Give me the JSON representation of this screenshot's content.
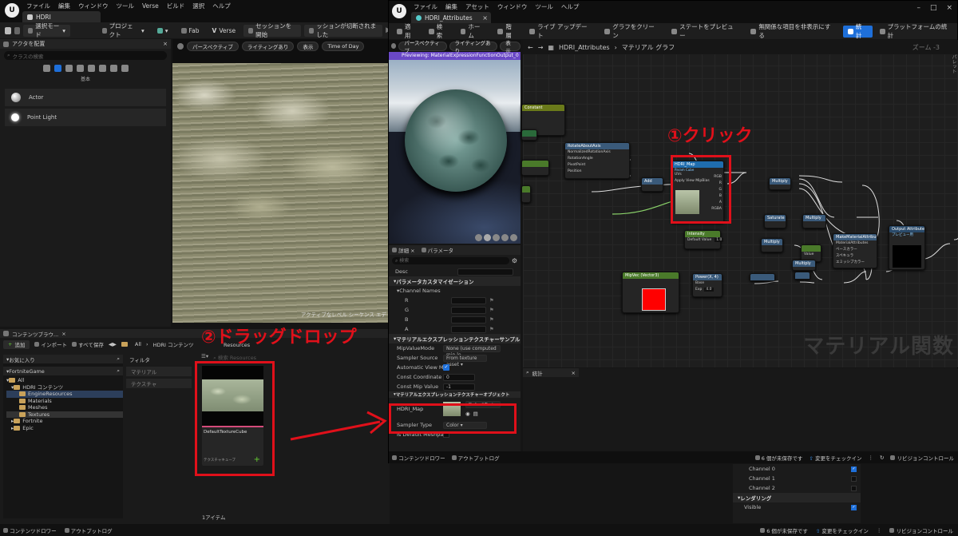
{
  "left_window": {
    "title_tab": "HDRI",
    "menu": [
      "ファイル",
      "編集",
      "ウィンドウ",
      "ツール",
      "Verse",
      "ビルド",
      "選択",
      "ヘルプ"
    ],
    "toolbar": {
      "select_mode": "選択モード",
      "project": "プロジェクト",
      "fab": "Fab",
      "verse": "Verse",
      "session": "セッションを開始",
      "disconnected": "ッションが切断されました"
    },
    "place_actors": {
      "title": "アクタを配置",
      "search_placeholder": "クラスの検索",
      "category": "基本",
      "items": [
        "Actor",
        "Point Light"
      ]
    },
    "viewport": {
      "perspective": "パースペクティブ",
      "lighting": "ライティングあり",
      "show": "表示",
      "time_of_day": "Time of Day",
      "active_sequence": "アクティブなレベル シーケンス エデ"
    },
    "content_browser": {
      "tab": "コンテンツブラウ...",
      "add": "追加",
      "import": "インポート",
      "save_all": "すべて保存",
      "path_all": "All",
      "path_hdri": "HDRI コンテンツ",
      "favorites": "お気に入り",
      "project": "FortniteGame",
      "tree": [
        "All",
        "HDRI コンテンツ",
        "EngineResources",
        "Materials",
        "Meshes",
        "Textures",
        "Fortnite",
        "Epic"
      ],
      "filter": "フィルタ",
      "filters": [
        "マテリアル",
        "テクスチャ"
      ],
      "resources": "Resources",
      "search_placeholder": "検索 Resources",
      "asset_name": "DefaultTextureCube",
      "asset_type": "テクスチャキューブ",
      "item_count": "1アイテム"
    },
    "bottom": {
      "drawer": "コンテンツドロワー",
      "output_log": "アウトプットログ",
      "unsaved": "6 個が未保存です",
      "checkin": "変更をチェックイン",
      "revision": "リビジョンコントロール"
    }
  },
  "right_window": {
    "title_tab": "HDRI_Attributes",
    "menu": [
      "ファイル",
      "編集",
      "アセット",
      "ウィンドウ",
      "ツール",
      "ヘルプ"
    ],
    "toolbar": [
      "適用",
      "検索",
      "ホーム",
      "階層",
      "ライブ アップデート",
      "グラフをクリーン",
      "ステートをプレビュー",
      "無関係な項目を非表示にする",
      "統計",
      "プラットフォームの統計"
    ],
    "breadcrumb": {
      "asset": "HDRI_Attributes",
      "graph": "マテリアル グラフ",
      "zoom": "ズーム -3",
      "palette": "パレット"
    },
    "preview": {
      "perspective": "パースペクティブ",
      "lighting": "ライティングあり",
      "show": "表示",
      "previewing": "Previewing: MaterialExpressionFunctionOutput_0"
    },
    "details": {
      "tab_details": "詳細",
      "tab_params": "パラメータ",
      "search": "検索",
      "desc": "Desc",
      "section_param": "パラメータカスタマイゼーション",
      "channel_names": "Channel Names",
      "channels": [
        "R",
        "G",
        "B",
        "A"
      ],
      "section_sampler": "マテリアルエクスプレッションテクスチャーサンプル",
      "mip_mode_label": "MipValueMode",
      "mip_mode_value": "None (use computed mip le",
      "sampler_source_label": "Sampler Source",
      "sampler_source_value": "From texture asset",
      "auto_mip": "Automatic View Mip B...",
      "const_coord": "Const Coordinate",
      "const_coord_value": "0",
      "const_mip": "Const Mip Value",
      "const_mip_value": "-1",
      "hidden_section": "マテリアルエクスプレッションテクスチャーオブジェクト",
      "hdri_label": "HDRI_Map",
      "hdri_value": "DefaultTexture",
      "sampler_type": "Sampler Type",
      "sampler_type_value": "Color",
      "is_default": "Is Default Meshpaint..."
    },
    "graph": {
      "watermark": "マテリアル関数",
      "hdri_node": "HDRI_Map",
      "hdri_node_sub": "Param Cube",
      "hdri_uvs": "UVs",
      "hdri_apply": "Apply View MipBias",
      "pins": [
        "RGB",
        "R",
        "G",
        "B",
        "A",
        "RGBA"
      ],
      "output_node": "Output Attributes",
      "output_sub": "プレビュー用",
      "make_attr": "MakeMaterialAttributes",
      "make_pins": [
        "MaterialAttributes",
        "ベースカラー",
        "スペキュラ",
        "エミッシブカラー"
      ],
      "rotate_node": "RotateAboutAxis",
      "rotate_pins": [
        "NormalizedRotationAxis",
        "RotationAngle",
        "PivotPoint",
        "Position"
      ],
      "add": "Add",
      "multiply": "Multiply",
      "saturate": "Saturate",
      "intensity": "Intensity",
      "default_value": "Default Value",
      "default_value_num": "1.0",
      "value_label": "Value",
      "value_num": "0.5",
      "power": "Power(X, 4)",
      "base": "Base",
      "exp": "Exp",
      "exp_val": "4.0",
      "mip_node": "MipVec (Vector3)",
      "constant": "Constant",
      "stats_tab": "統計"
    },
    "bottom": {
      "drawer": "コンテンツドロワー",
      "output_log": "アウトプットログ",
      "unsaved": "6 個が未保存です",
      "checkin": "変更をチェックイン",
      "revision": "リビジョンコントロール",
      "channel0": "Channel 0",
      "channel1": "Channel 1",
      "channel2": "Channel 2",
      "rendering": "レンダリング",
      "visible": "Visible"
    }
  },
  "annotations": {
    "click": "①クリック",
    "drag_drop": "②ドラッグドロップ"
  },
  "colors": {
    "accent_blue": "#1e6fd9",
    "annotation_red": "#e0101a",
    "node_green": "#4a7a2a",
    "node_blue": "#2a5a8a",
    "hdri_head": "#1f6dae"
  }
}
